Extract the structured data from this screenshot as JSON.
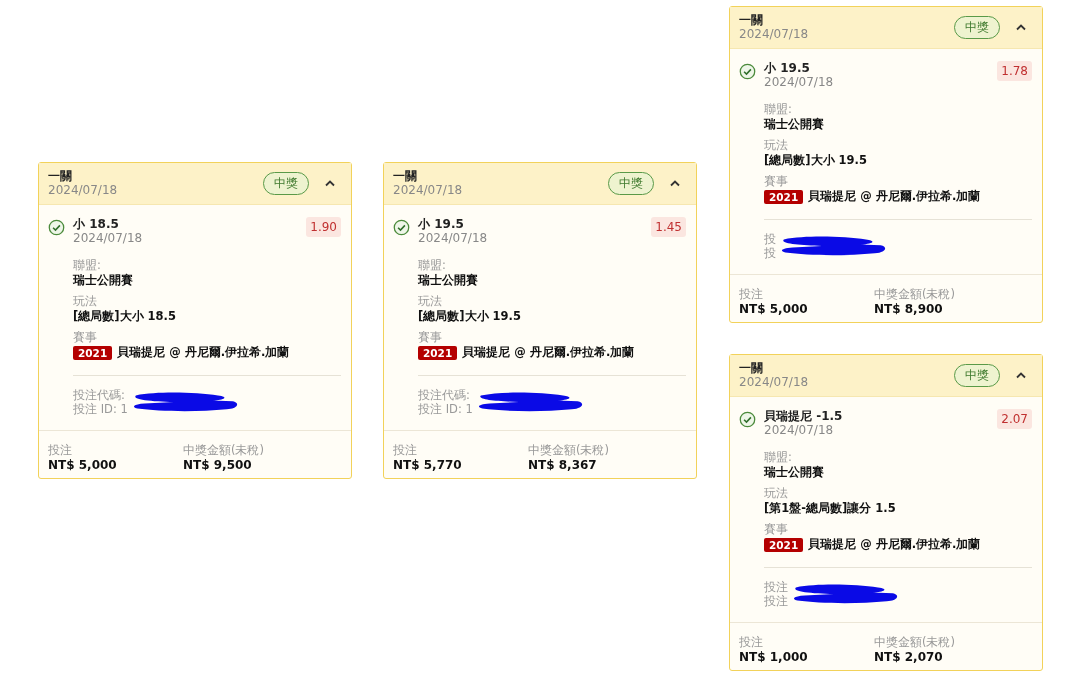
{
  "cards": [
    {
      "title": "一關",
      "date": "2024/07/18",
      "status": "中獎",
      "expanded": true,
      "selection": {
        "won": true,
        "pick": "小 18.5",
        "date": "2024/07/18",
        "odds": "1.90"
      },
      "fields": [
        {
          "label": "聯盟:",
          "value": "瑞士公開賽"
        },
        {
          "label": "玩法",
          "value": "[總局數]大小 18.5"
        }
      ],
      "event": {
        "label": "賽事",
        "tag": "2021",
        "teams": "貝瑞提尼 @ 丹尼爾.伊拉希.加蘭"
      },
      "ref_lines": [
        "投注代碼:",
        "投注 ID: 1"
      ],
      "stake": {
        "label": "投注",
        "value": "NT$ 5,000"
      },
      "payout": {
        "label": "中獎金額(未稅)",
        "value": "NT$ 9,500"
      }
    },
    {
      "title": "一關",
      "date": "2024/07/18",
      "status": "中獎",
      "expanded": true,
      "selection": {
        "won": true,
        "pick": "小 19.5",
        "date": "2024/07/18",
        "odds": "1.45"
      },
      "fields": [
        {
          "label": "聯盟:",
          "value": "瑞士公開賽"
        },
        {
          "label": "玩法",
          "value": "[總局數]大小 19.5"
        }
      ],
      "event": {
        "label": "賽事",
        "tag": "2021",
        "teams": "貝瑞提尼 @ 丹尼爾.伊拉希.加蘭"
      },
      "ref_lines": [
        "投注代碼:",
        "投注 ID: 1"
      ],
      "stake": {
        "label": "投注",
        "value": "NT$ 5,770"
      },
      "payout": {
        "label": "中獎金額(未稅)",
        "value": "NT$ 8,367"
      }
    },
    {
      "title": "一關",
      "date": "2024/07/18",
      "status": "中獎",
      "expanded": true,
      "selection": {
        "won": true,
        "pick": "小 19.5",
        "date": "2024/07/18",
        "odds": "1.78"
      },
      "fields": [
        {
          "label": "聯盟:",
          "value": "瑞士公開賽"
        },
        {
          "label": "玩法",
          "value": "[總局數]大小 19.5"
        }
      ],
      "event": {
        "label": "賽事",
        "tag": "2021",
        "teams": "貝瑞提尼 @ 丹尼爾.伊拉希.加蘭"
      },
      "ref_lines": [
        "投",
        "投"
      ],
      "stake": {
        "label": "投注",
        "value": "NT$ 5,000"
      },
      "payout": {
        "label": "中獎金額(未稅)",
        "value": "NT$ 8,900"
      }
    },
    {
      "title": "一關",
      "date": "2024/07/18",
      "status": "中獎",
      "expanded": true,
      "selection": {
        "won": true,
        "pick": "貝瑞提尼 -1.5",
        "date": "2024/07/18",
        "odds": "2.07"
      },
      "fields": [
        {
          "label": "聯盟:",
          "value": "瑞士公開賽"
        },
        {
          "label": "玩法",
          "value": "[第1盤-總局數]讓分 1.5"
        }
      ],
      "event": {
        "label": "賽事",
        "tag": "2021",
        "teams": "貝瑞提尼 @ 丹尼爾.伊拉希.加蘭"
      },
      "ref_lines": [
        "投注",
        "投注"
      ],
      "stake": {
        "label": "投注",
        "value": "NT$ 1,000"
      },
      "payout": {
        "label": "中獎金額(未稅)",
        "value": "NT$ 2,070"
      }
    }
  ]
}
